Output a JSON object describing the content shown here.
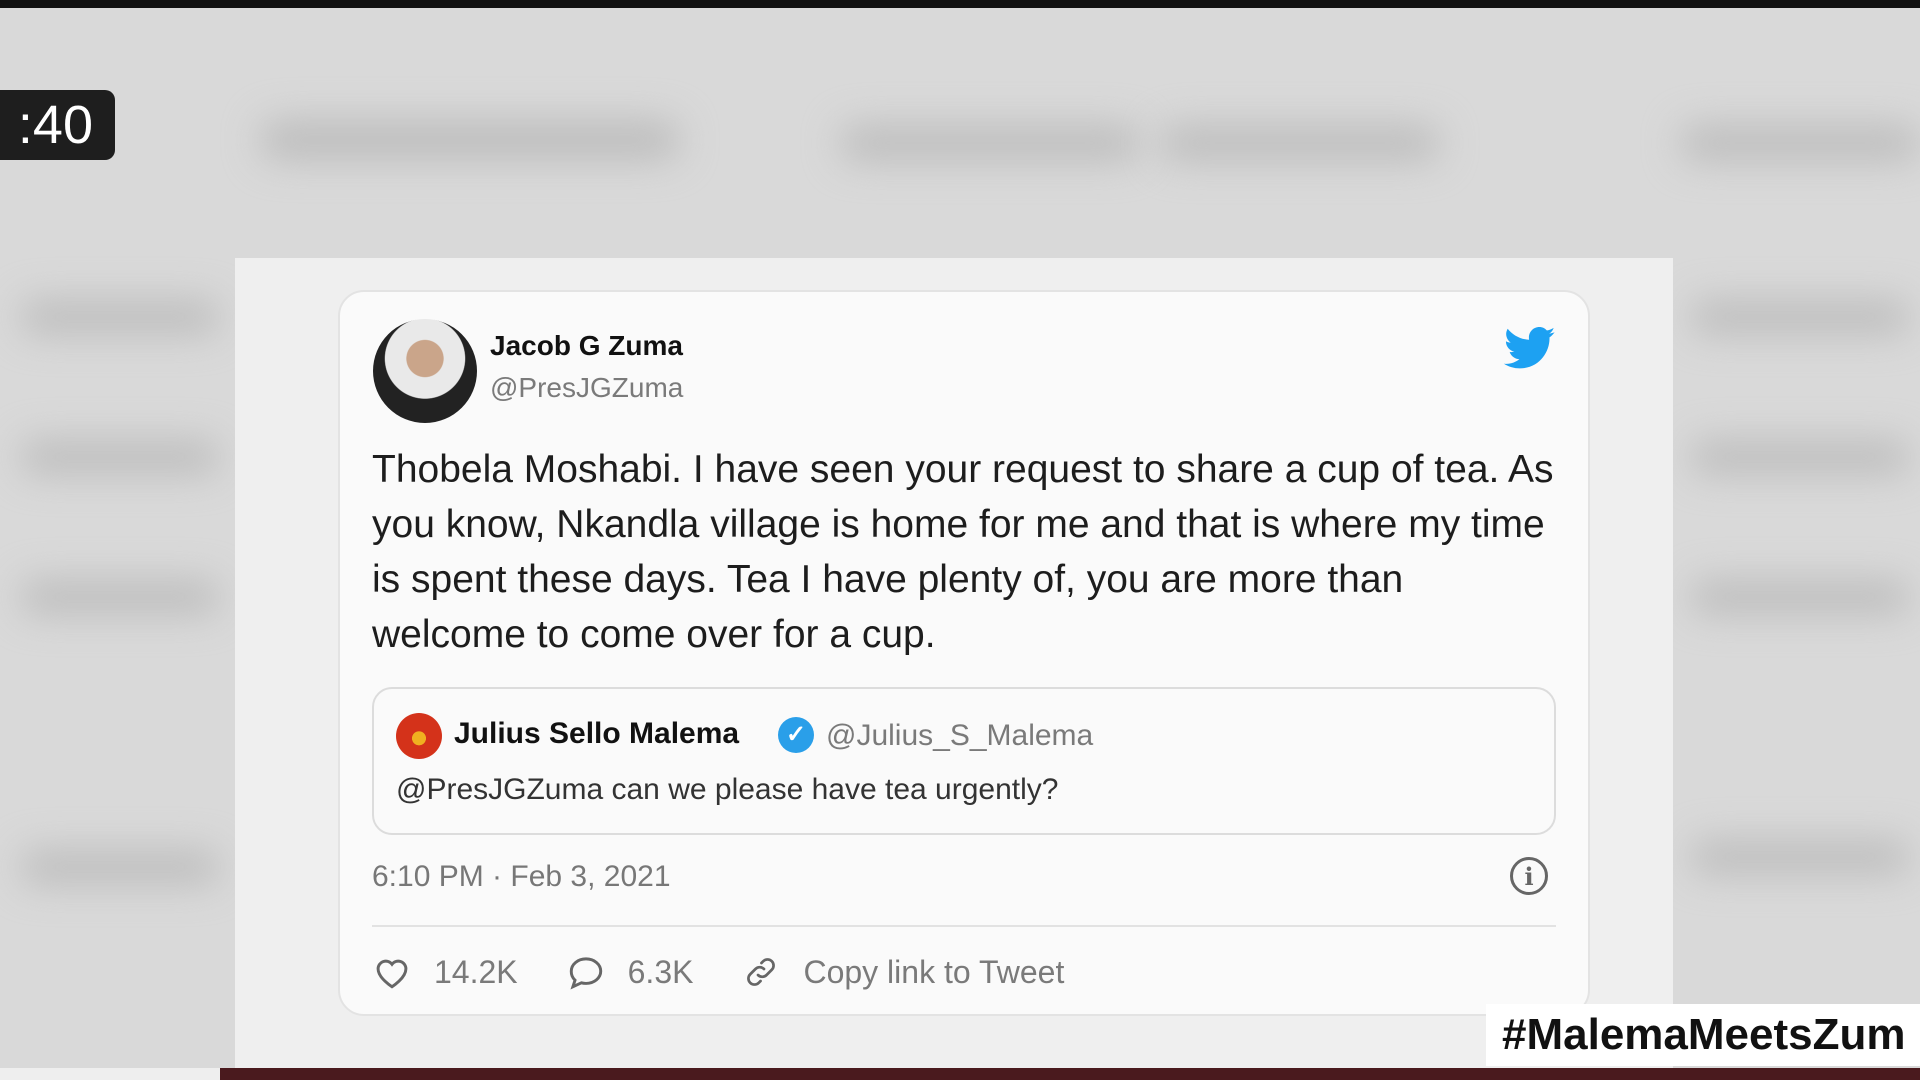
{
  "overlay": {
    "timer": ":40",
    "hashtag": "#MalemaMeetsZum"
  },
  "tweet": {
    "author_name": "Jacob G Zuma",
    "author_handle": "@PresJGZuma",
    "text": "Thobela Moshabi. I have seen your request to share a cup of tea. As you know, Nkandla village is home for me and that is where my time is spent these days. Tea I have plenty of, you are more than welcome to come over for a cup.",
    "timestamp": "6:10 PM · Feb 3, 2021",
    "likes": "14.2K",
    "replies": "6.3K",
    "copy_link_label": "Copy link to Tweet",
    "brand_icon": "twitter-bird-icon",
    "brand_color": "#1da1f2"
  },
  "quoted_tweet": {
    "author_name": "Julius Sello Malema",
    "author_handle": "@Julius_S_Malema",
    "text": "@PresJGZuma can we please have tea urgently?",
    "verified": true
  }
}
